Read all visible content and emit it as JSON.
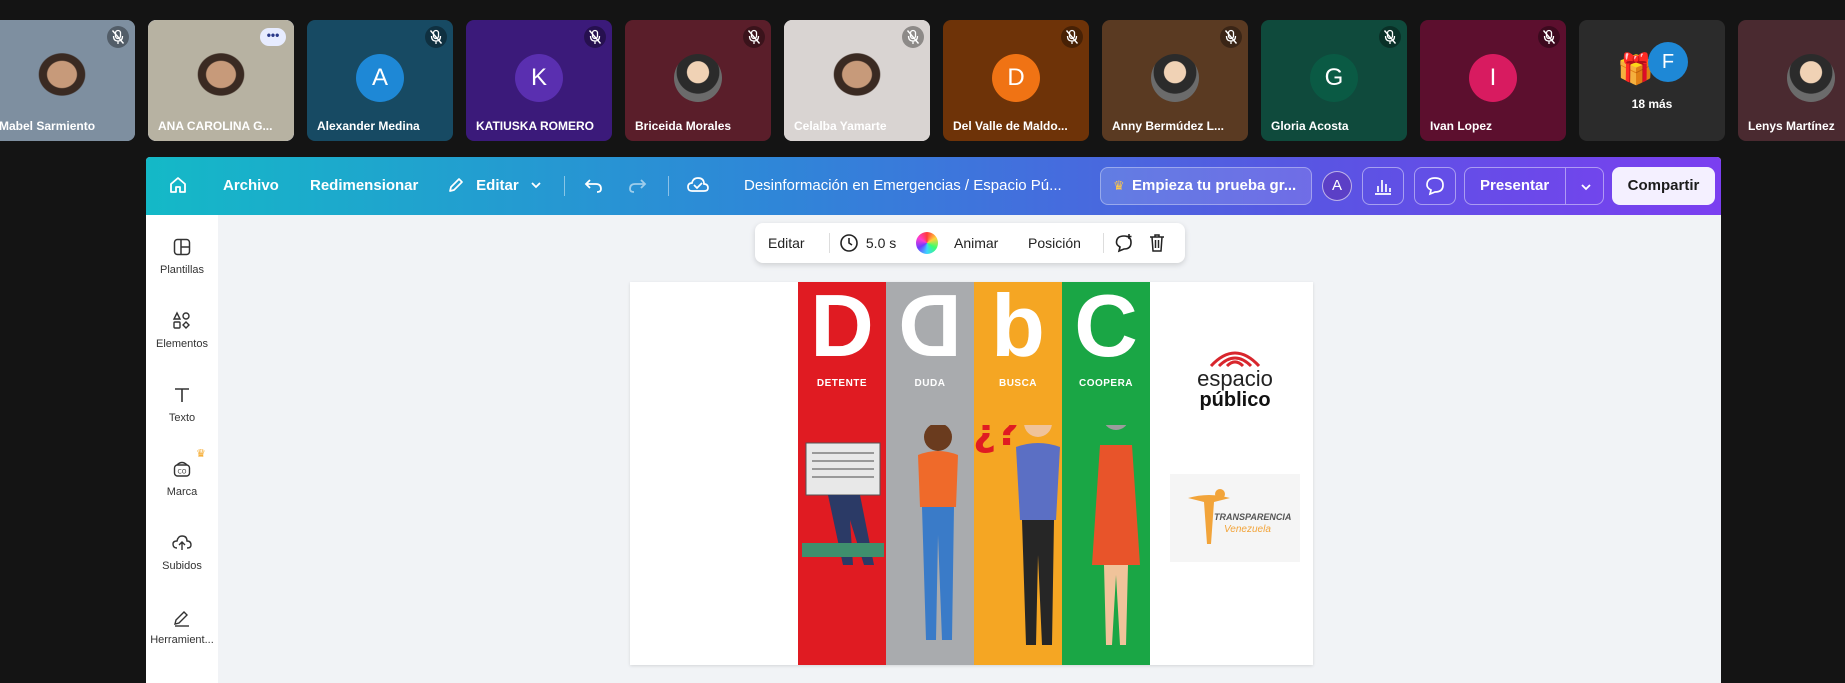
{
  "participants": [
    {
      "name": "Mabel Sarmiento",
      "kind": "video",
      "bg": "#7e8fa0"
    },
    {
      "name": "ANA CAROLINA G...",
      "kind": "video",
      "bg": "#b7b2a2",
      "active": true
    },
    {
      "name": "Alexander Medina",
      "kind": "avatar",
      "initial": "A",
      "bg": "#174a63",
      "avatar_color": "#1e88d6"
    },
    {
      "name": "KATIUSKA ROMERO",
      "kind": "avatar",
      "initial": "K",
      "bg": "#3b1a7a",
      "avatar_color": "#5a2fb0"
    },
    {
      "name": "Briceida Morales",
      "kind": "photo",
      "bg": "#5a1e2a"
    },
    {
      "name": "Celalba Yamarte",
      "kind": "video",
      "bg": "#d9d4d2"
    },
    {
      "name": "Del Valle de Maldo...",
      "kind": "avatar",
      "initial": "D",
      "bg": "#6e3308",
      "avatar_color": "#f07314"
    },
    {
      "name": "Anny Bermúdez L...",
      "kind": "photo",
      "bg": "#5a3a22"
    },
    {
      "name": "Gloria Acosta",
      "kind": "avatar",
      "initial": "G",
      "bg": "#0f4a3c",
      "avatar_color": "#0a5a44"
    },
    {
      "name": "Ivan Lopez",
      "kind": "avatar",
      "initial": "I",
      "bg": "#5c0f2e",
      "avatar_color": "#d81b60"
    },
    {
      "name": "18 más",
      "kind": "more",
      "bg": "#2b2b2b",
      "avatar_color": "#1e88d6",
      "initial": "F"
    },
    {
      "name": "Lenys Martínez",
      "kind": "photo",
      "bg": "#4a2a30"
    }
  ],
  "topbar": {
    "archivo": "Archivo",
    "redimensionar": "Redimensionar",
    "editar": "Editar",
    "doc_title": "Desinformación en Emergencias / Espacio Pú...",
    "trial": "Empieza tu prueba gr...",
    "avatar_initial": "A",
    "presentar": "Presentar",
    "compartir": "Compartir"
  },
  "sidebar": {
    "items": [
      {
        "label": "Plantillas"
      },
      {
        "label": "Elementos"
      },
      {
        "label": "Texto"
      },
      {
        "label": "Marca"
      },
      {
        "label": "Subidos"
      },
      {
        "label": "Herramient..."
      }
    ]
  },
  "float_toolbar": {
    "editar": "Editar",
    "duration": "5.0 s",
    "animar": "Animar",
    "posicion": "Posición"
  },
  "slide": {
    "bands": [
      {
        "letter": "D",
        "label": "DETENTE",
        "color": "#e01b22"
      },
      {
        "letter": "D",
        "label": "DUDA",
        "color": "#a9abae"
      },
      {
        "letter": "b",
        "label": "BUSCA",
        "color": "#f5a623"
      },
      {
        "letter": "C",
        "label": "COOPERA",
        "color": "#1aa645"
      }
    ],
    "logo1_line1": "espacio",
    "logo1_line2": "público",
    "logo2_line1": "TRANSPARENCIA",
    "logo2_line2": "Venezuela"
  },
  "colors": {
    "accent_teal": "#14b9c7",
    "accent_purple": "#7b3ff0"
  }
}
